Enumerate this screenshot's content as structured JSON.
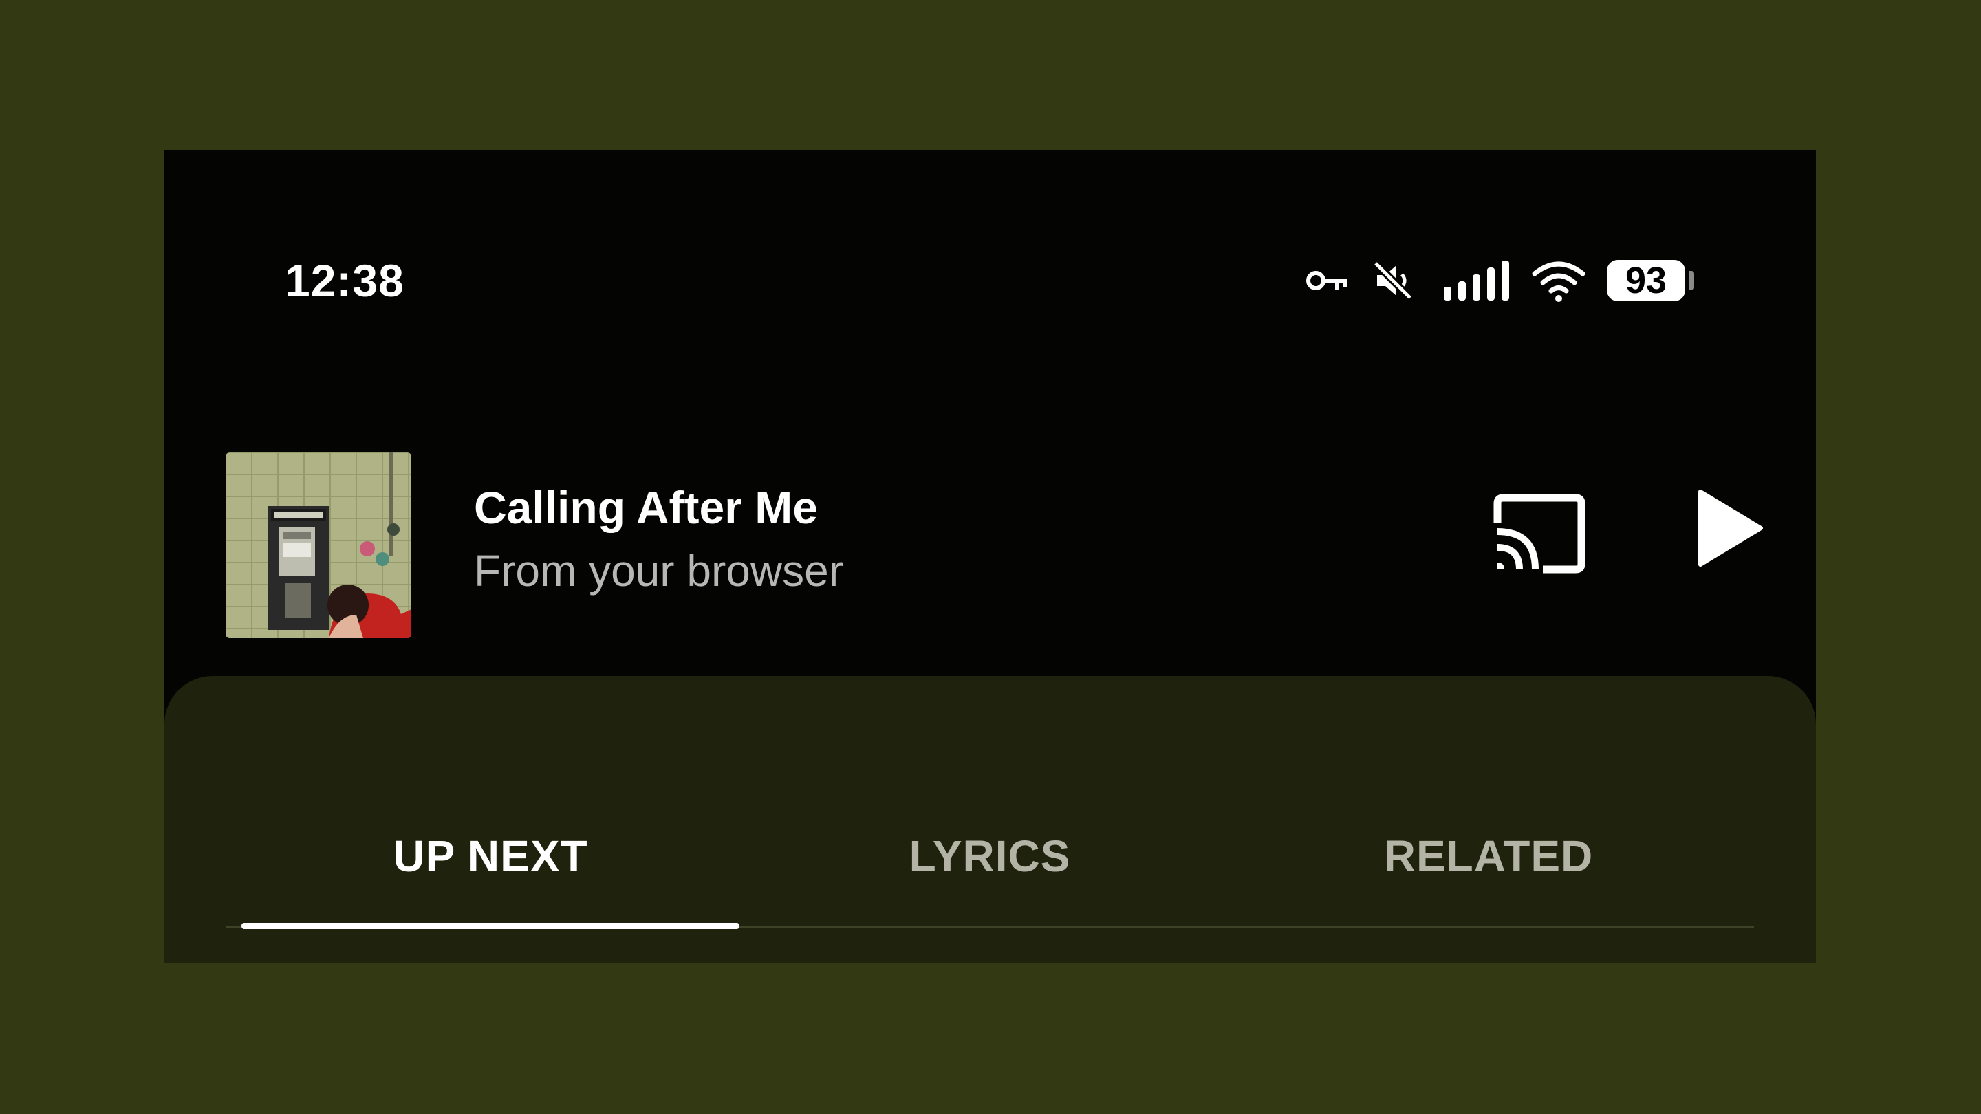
{
  "status_bar": {
    "time": "12:38",
    "icons": [
      "vpn-key-icon",
      "mute-icon",
      "cellular-signal-icon",
      "wifi-icon"
    ],
    "battery": "93"
  },
  "now_playing": {
    "title": "Calling After Me",
    "subtitle": "From your browser",
    "art_icon": "album-art",
    "cast_icon": "cast-icon",
    "play_icon": "play-icon"
  },
  "tabs": [
    {
      "label": "UP NEXT",
      "active": true
    },
    {
      "label": "LYRICS",
      "active": false
    },
    {
      "label": "RELATED",
      "active": false
    }
  ],
  "colors": {
    "background": "#333913",
    "screen": "#040403",
    "sheet": "#1f220c",
    "accent": "#ffffff"
  }
}
